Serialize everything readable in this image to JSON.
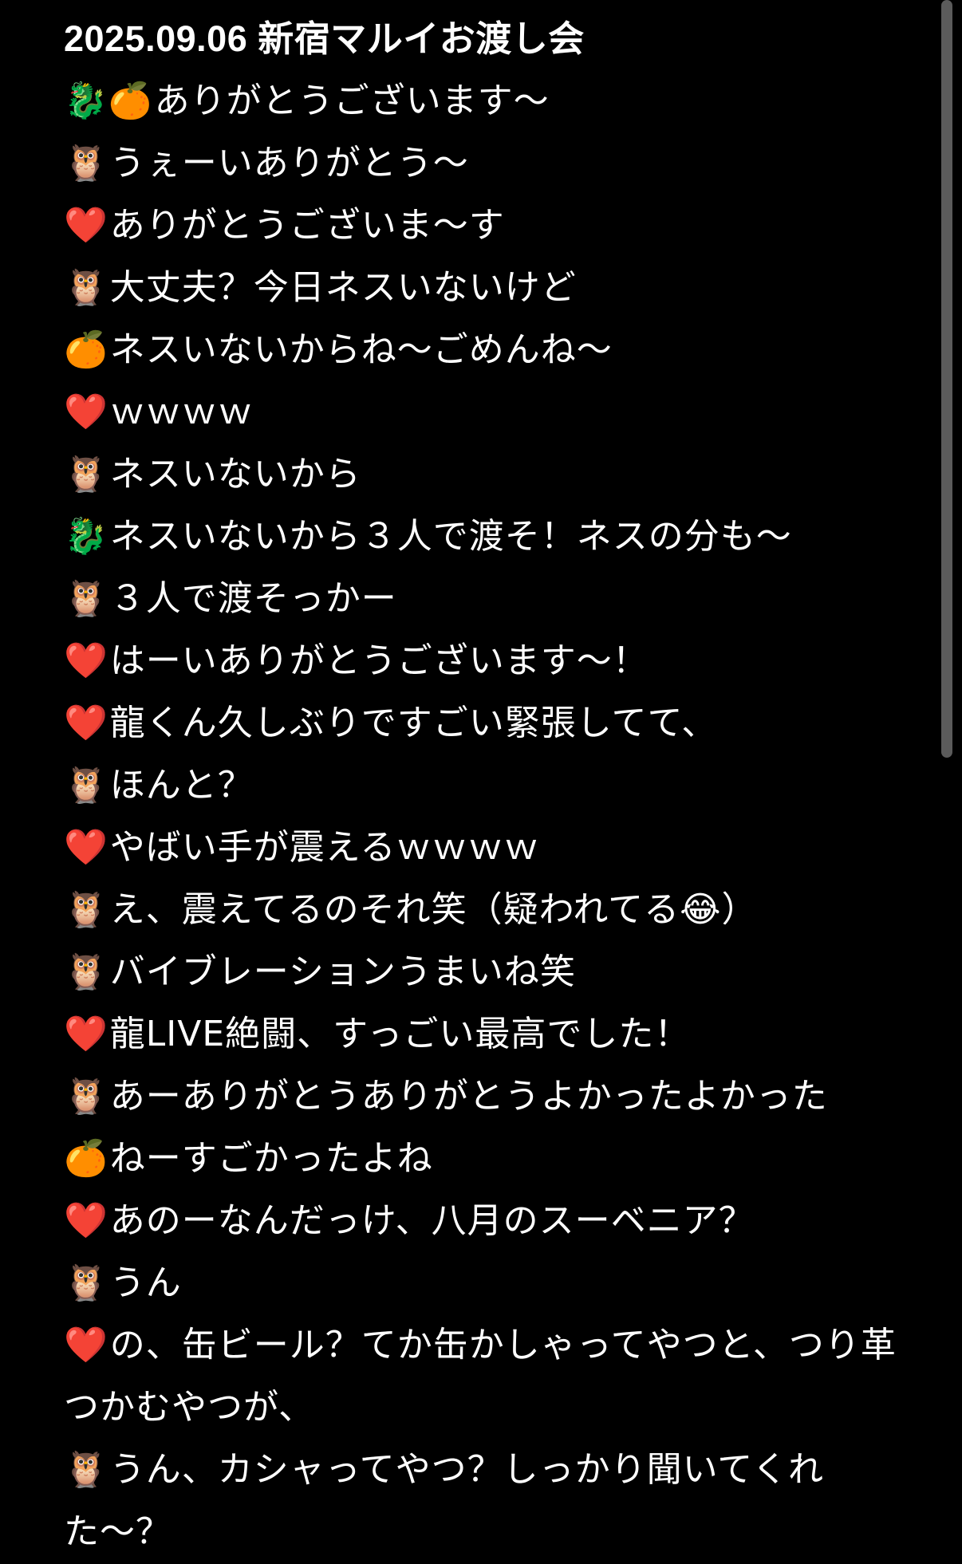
{
  "title": "2025.09.06 新宿マルイお渡し会",
  "lines": [
    {
      "emoji": "🐉🍊",
      "text": "ありがとうございます〜"
    },
    {
      "emoji": "🦉",
      "text": "うぇーいありがとう〜"
    },
    {
      "emoji": "❤️",
      "text": "ありがとうございま〜す"
    },
    {
      "emoji": "🦉",
      "text": "大丈夫？今日ネスいないけど"
    },
    {
      "emoji": "🍊",
      "text": "ネスいないからね〜ごめんね〜"
    },
    {
      "emoji": "❤️",
      "text": "ｗｗｗｗ"
    },
    {
      "emoji": "🦉",
      "text": "ネスいないから"
    },
    {
      "emoji": "🐉",
      "text": "ネスいないから３人で渡そ！ネスの分も〜"
    },
    {
      "emoji": "🦉",
      "text": "３人で渡そっかー"
    },
    {
      "emoji": "❤️",
      "text": "はーいありがとうございます〜！"
    },
    {
      "emoji": "❤️",
      "text": "龍くん久しぶりですごい緊張してて、"
    },
    {
      "emoji": "🦉",
      "text": "ほんと？"
    },
    {
      "emoji": "❤️",
      "text": "やばい手が震えるｗｗｗｗ"
    },
    {
      "emoji": "🦉",
      "text": "え、震えてるのそれ笑（疑われてる😂）"
    },
    {
      "emoji": "🦉",
      "text": "バイブレーションうまいね笑"
    },
    {
      "emoji": "❤️",
      "text": "龍LIVE絶闘、すっごい最高でした！"
    },
    {
      "emoji": "🦉",
      "text": "あーありがとうありがとうよかったよかった"
    },
    {
      "emoji": "🍊",
      "text": "ねーすごかったよね"
    },
    {
      "emoji": "❤️",
      "text": "あのーなんだっけ、八月のスーベニア？"
    },
    {
      "emoji": "🦉",
      "text": "うん"
    },
    {
      "emoji": "❤️",
      "text": "の、缶ビール？てか缶かしゃってやつと、つり革つかむやつが、"
    },
    {
      "emoji": "🦉",
      "text": "うん、カシャってやつ？しっかり聞いてくれた〜？"
    }
  ]
}
